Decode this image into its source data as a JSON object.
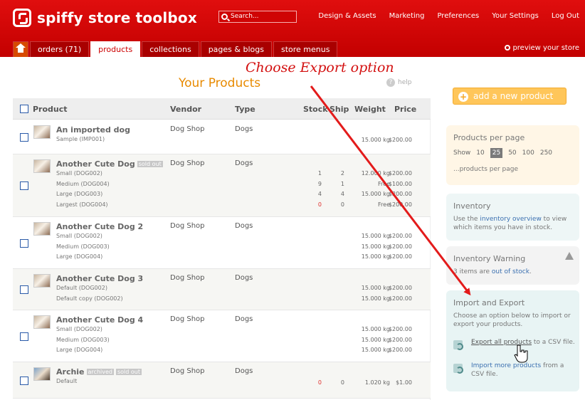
{
  "app": {
    "name": "spiffy store toolbox"
  },
  "search": {
    "placeholder": "Search..."
  },
  "topnav": [
    "Design & Assets",
    "Marketing",
    "Preferences",
    "Your Settings",
    "Log Out"
  ],
  "tabs": [
    "orders (71)",
    "products",
    "collections",
    "pages & blogs",
    "store menus"
  ],
  "active_tab": "products",
  "preview_label": "preview your store",
  "annotation": "Choose Export option",
  "page_title": "Your Products",
  "help_label": "help",
  "table": {
    "headers": {
      "product": "Product",
      "vendor": "Vendor",
      "type": "Type",
      "stock": "Stock",
      "ship": "Ship",
      "weight": "Weight",
      "price": "Price"
    },
    "products": [
      {
        "name": "An imported dog",
        "badges": [],
        "vendor": "Dog Shop",
        "type": "Dogs",
        "variants": [
          {
            "name": "Sample (IMP001)",
            "stock": "",
            "ship": "",
            "weight": "15.000 kg",
            "price": "$200.00"
          }
        ]
      },
      {
        "name": "Another Cute Dog",
        "badges": [
          "sold out"
        ],
        "vendor": "Dog Shop",
        "type": "Dogs",
        "variants": [
          {
            "name": "Small (DOG002)",
            "stock": "1",
            "ship": "2",
            "weight": "12.000 kg",
            "price": "$200.00"
          },
          {
            "name": "Medium (DOG004)",
            "stock": "9",
            "ship": "1",
            "weight": "Free",
            "price": "$100.00"
          },
          {
            "name": "Large (DOG003)",
            "stock": "4",
            "ship": "4",
            "weight": "15.000 kg",
            "price": "$200.00"
          },
          {
            "name": "Largest (DOG004)",
            "stock": "0",
            "ship": "0",
            "weight": "Free",
            "price": "$200.00",
            "stock_red": true
          }
        ]
      },
      {
        "name": "Another Cute Dog 2",
        "badges": [],
        "vendor": "Dog Shop",
        "type": "Dogs",
        "variants": [
          {
            "name": "Small (DOG002)",
            "stock": "",
            "ship": "",
            "weight": "15.000 kg",
            "price": "$200.00"
          },
          {
            "name": "Medium (DOG003)",
            "stock": "",
            "ship": "",
            "weight": "15.000 kg",
            "price": "$200.00"
          },
          {
            "name": "Large (DOG004)",
            "stock": "",
            "ship": "",
            "weight": "15.000 kg",
            "price": "$200.00"
          }
        ]
      },
      {
        "name": "Another Cute Dog 3",
        "badges": [],
        "vendor": "Dog Shop",
        "type": "Dogs",
        "variants": [
          {
            "name": "Default (DOG002)",
            "stock": "",
            "ship": "",
            "weight": "15.000 kg",
            "price": "$200.00"
          },
          {
            "name": "Default copy (DOG002)",
            "stock": "",
            "ship": "",
            "weight": "15.000 kg",
            "price": "$200.00"
          }
        ]
      },
      {
        "name": "Another Cute Dog 4",
        "badges": [],
        "vendor": "Dog Shop",
        "type": "Dogs",
        "variants": [
          {
            "name": "Small (DOG002)",
            "stock": "",
            "ship": "",
            "weight": "15.000 kg",
            "price": "$200.00"
          },
          {
            "name": "Medium (DOG003)",
            "stock": "",
            "ship": "",
            "weight": "15.000 kg",
            "price": "$200.00"
          },
          {
            "name": "Large (DOG004)",
            "stock": "",
            "ship": "",
            "weight": "15.000 kg",
            "price": "$200.00"
          }
        ]
      },
      {
        "name": "Archie",
        "badges": [
          "archived",
          "sold out"
        ],
        "vendor": "Dog Shop",
        "type": "Dogs",
        "variants": [
          {
            "name": "Default",
            "stock": "0",
            "ship": "0",
            "weight": "1.020 kg",
            "price": "$1.00",
            "stock_red": true
          }
        ]
      }
    ]
  },
  "sidebar": {
    "add_product": "add a new product",
    "per_page": {
      "title": "Products per page",
      "show": "Show",
      "options": [
        "10",
        "25",
        "50",
        "100",
        "250"
      ],
      "selected": "25",
      "caption": "...products per page"
    },
    "inventory": {
      "title": "Inventory",
      "pre": "Use the ",
      "link": "inventory overview",
      "post": " to view which items you have in stock."
    },
    "warning": {
      "title": "Inventory Warning",
      "pre": "3 items are ",
      "link": "out of stock",
      "post": "."
    },
    "import_export": {
      "title": "Import and Export",
      "text": "Choose an option below to import or export your products.",
      "export_link": "Export all products",
      "export_rest": " to a CSV file.",
      "import_link": "Import more products",
      "import_rest": " from a CSV file."
    }
  },
  "colors": {
    "header_red": "#d90000",
    "title_orange": "#e88a00",
    "annotation_red": "#d31010",
    "link_blue": "#3a6fb0"
  }
}
